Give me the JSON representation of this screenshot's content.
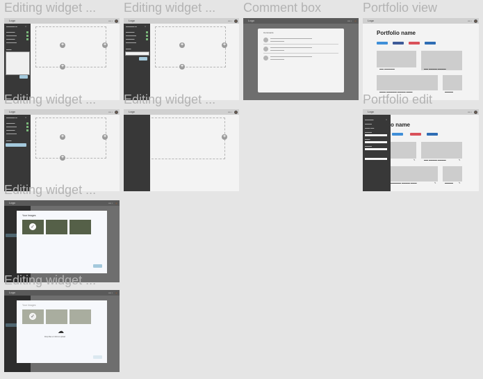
{
  "frames": {
    "ew1": {
      "title": "Editing widget ..."
    },
    "ew2": {
      "title": "Editing widget ..."
    },
    "comment": {
      "title": "Comment box"
    },
    "pview": {
      "title": "Portfolio view"
    },
    "ew3": {
      "title": "Editing widget ..."
    },
    "ew4": {
      "title": "Editing widget ..."
    },
    "pedit": {
      "title": "Portfolio edit"
    },
    "ew5": {
      "title": "Editing widget ..."
    },
    "ew6": {
      "title": "Editing widget ..."
    }
  },
  "app": {
    "logo": "Logo"
  },
  "portfolio": {
    "name": "Portfolio name",
    "edit_name": "folio name"
  },
  "modal": {
    "title": "Your Images",
    "upload_text": "Drop files or click to upload"
  },
  "comment_box": {
    "heading": "Comments"
  },
  "colors": {
    "canvas_bg": "#e5e5e5",
    "sidebar_bg": "#383838",
    "frame_bg": "#f3f3f3",
    "accent_blue": "#a4c9dc",
    "share_twitter": "#3f8fd8",
    "share_facebook": "#3d5a98",
    "share_pinterest": "#d9515a",
    "share_linkedin": "#2e6db4"
  }
}
